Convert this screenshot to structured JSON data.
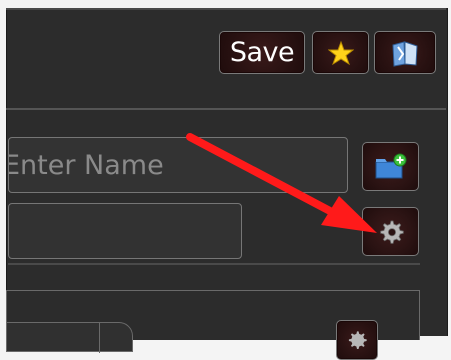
{
  "toolbar": {
    "save_label": "Save",
    "favorite_icon": "star-icon",
    "library_icon": "book-icon"
  },
  "form": {
    "name_placeholder": "Enter Name",
    "browse_icon": "folder-add-icon",
    "settings_icon": "gear-icon"
  },
  "annotation": {
    "color": "#ff1a1a",
    "target": "settings-gear-button"
  },
  "colors": {
    "panel_bg": "#2c2c2c",
    "button_bg": "#2a1212",
    "accent_star": "#ffd21a"
  }
}
